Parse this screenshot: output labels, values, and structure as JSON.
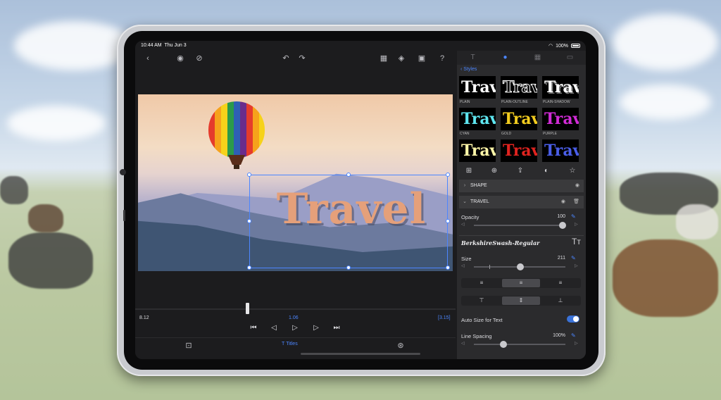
{
  "status_bar": {
    "time": "10:44 AM",
    "date": "Thu Jun 3",
    "battery": "100%"
  },
  "editor": {
    "title_text": "Travel",
    "timecode_left": "8.12",
    "timecode_current": "1.06",
    "timecode_right": "[3.15]",
    "bottom_tab_label": "Titles",
    "icons": {
      "back": "chevron-left-icon",
      "eye": "eye-icon",
      "eye_hidden": "eye-slash-icon",
      "undo": "undo-icon",
      "redo": "redo-icon",
      "checkerboard": "checkerboard-icon",
      "layers": "layers-icon",
      "export": "export-icon",
      "help": "help-icon"
    }
  },
  "panel": {
    "styles_header": "Styles",
    "style_tiles": [
      {
        "text": "Trav",
        "label": "PLAIN",
        "color": "#ffffff"
      },
      {
        "text": "Trav",
        "label": "PLAIN-OUTLINE",
        "color": "#ffffff"
      },
      {
        "text": "Trav",
        "label": "PLAIN-SHADOW",
        "color": "#ffffff"
      },
      {
        "text": "Trav",
        "label": "CYAN",
        "color": "#5ee6f0"
      },
      {
        "text": "Trav",
        "label": "GOLD",
        "color": "#f2cc1f"
      },
      {
        "text": "Trav",
        "label": "PURPLE",
        "color": "#d12bd6"
      },
      {
        "text": "Trav",
        "label": "",
        "color": "#fff6a8"
      },
      {
        "text": "Trav",
        "label": "",
        "color": "#e0231f"
      },
      {
        "text": "Trav",
        "label": "",
        "color": "#4a5ee8"
      }
    ],
    "shape_section": "SHAPE",
    "travel_section": "TRAVEL",
    "opacity_label": "Opacity",
    "opacity_value": "100",
    "opacity_fraction": 1.0,
    "font_name": "BerkshireSwash-Regular",
    "size_label": "Size",
    "size_value": "211",
    "auto_size_label": "Auto Size for Text",
    "auto_size_on": true,
    "line_spacing_label": "Line Spacing",
    "line_spacing_value": "100%",
    "accent": "#4c86ff"
  }
}
